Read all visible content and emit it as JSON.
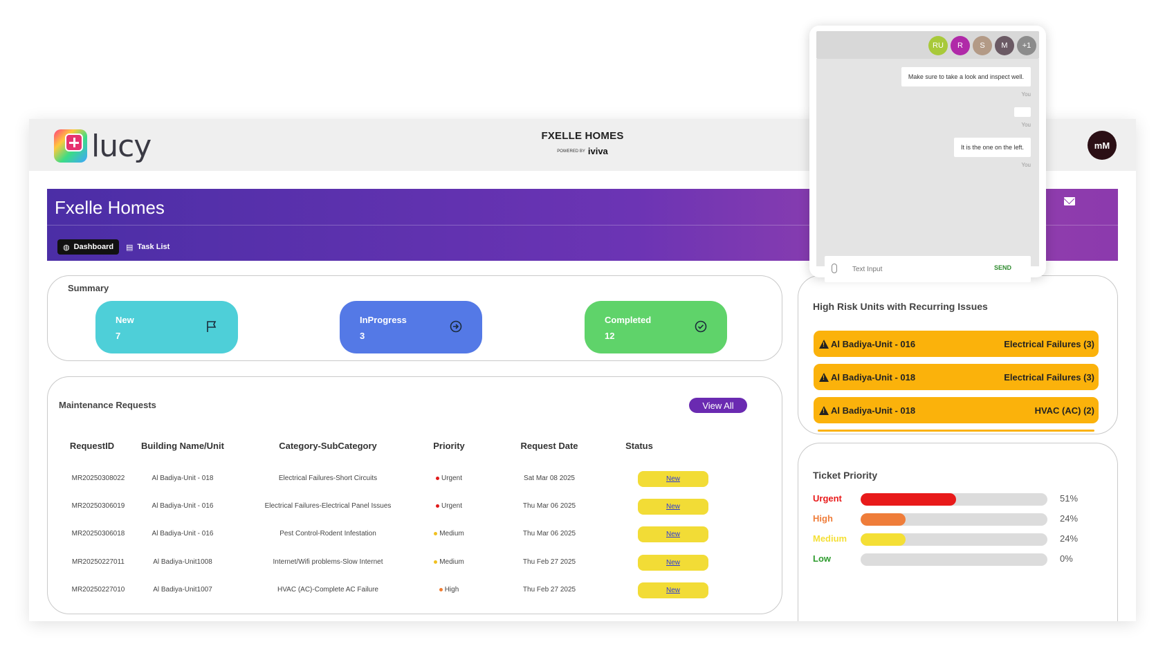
{
  "brand": {
    "logo_text": "lucy",
    "title": "FXELLE HOMES",
    "powered_by": "POWERED BY",
    "powered_brand": "iviva"
  },
  "user": {
    "initials": "mM"
  },
  "banner": {
    "title": "Fxelle Homes",
    "tabs": [
      {
        "label": "Dashboard",
        "active": true
      },
      {
        "label": "Task List",
        "active": false
      }
    ]
  },
  "summary": {
    "title": "Summary",
    "stats": [
      {
        "label": "New",
        "value": "7",
        "color": "#4ecfd8",
        "icon": "flag-icon"
      },
      {
        "label": "InProgress",
        "value": "3",
        "color": "#5479e6",
        "icon": "arrow-circle-icon"
      },
      {
        "label": "Completed",
        "value": "12",
        "color": "#5fd36a",
        "icon": "check-circle-icon"
      }
    ]
  },
  "maintenance": {
    "title": "Maintenance Requests",
    "view_all": "View All",
    "columns": [
      "RequestID",
      "Building Name/Unit",
      "Category-SubCategory",
      "Priority",
      "Request Date",
      "Status"
    ],
    "rows": [
      {
        "id": "MR20250308022",
        "unit": "Al Badiya-Unit - 018",
        "category": "Electrical Failures-Short Circuits",
        "priority": "Urgent",
        "priority_color": "#e01b1b",
        "date": "Sat Mar 08 2025",
        "status": "New"
      },
      {
        "id": "MR20250306019",
        "unit": "Al Badiya-Unit - 016",
        "category": "Electrical Failures-Electrical Panel Issues",
        "priority": "Urgent",
        "priority_color": "#e01b1b",
        "date": "Thu Mar 06 2025",
        "status": "New"
      },
      {
        "id": "MR20250306018",
        "unit": "Al Badiya-Unit - 016",
        "category": "Pest Control-Rodent Infestation",
        "priority": "Medium",
        "priority_color": "#f0c020",
        "date": "Thu Mar 06 2025",
        "status": "New"
      },
      {
        "id": "MR20250227011",
        "unit": "Al Badiya-Unit1008",
        "category": "Internet/Wifi problems-Slow Internet",
        "priority": "Medium",
        "priority_color": "#f0c020",
        "date": "Thu Feb 27 2025",
        "status": "New"
      },
      {
        "id": "MR20250227010",
        "unit": "Al Badiya-Unit1007",
        "category": "HVAC (AC)-Complete AC Failure",
        "priority": "High",
        "priority_color": "#f07c30",
        "date": "Thu Feb 27 2025",
        "status": "New"
      }
    ]
  },
  "risk": {
    "title": "High Risk Units with Recurring Issues",
    "items": [
      {
        "unit": "Al Badiya-Unit - 016",
        "issue": "Electrical Failures (3)"
      },
      {
        "unit": "Al Badiya-Unit - 018",
        "issue": "Electrical Failures (3)"
      },
      {
        "unit": "Al Badiya-Unit - 018",
        "issue": "HVAC (AC) (2)"
      }
    ]
  },
  "ticket_priority": {
    "title": "Ticket Priority",
    "items": [
      {
        "label": "Urgent",
        "percent": 51,
        "pct_text": "51%",
        "color": "#e81a1a"
      },
      {
        "label": "High",
        "percent": 24,
        "pct_text": "24%",
        "color": "#ef7d3a"
      },
      {
        "label": "Medium",
        "percent": 24,
        "pct_text": "24%",
        "color": "#f4df35"
      },
      {
        "label": "Low",
        "percent": 0,
        "pct_text": "0%",
        "color": "#2e9c2e"
      }
    ]
  },
  "chat": {
    "participants": [
      {
        "initials": "RU",
        "color": "#a8c93a"
      },
      {
        "initials": "R",
        "color": "#b02aa8"
      },
      {
        "initials": "S",
        "color": "#b39a86"
      },
      {
        "initials": "M",
        "color": "#6b5a64"
      },
      {
        "initials": "+1",
        "color": "#8c8c8c"
      }
    ],
    "messages": [
      {
        "text": "Make sure to take a look and inspect well.",
        "author": "You"
      },
      {
        "text": "",
        "author": "You"
      },
      {
        "text": "It is the one on the left.",
        "author": "You"
      }
    ],
    "input_placeholder": "Text Input",
    "send_label": "SEND"
  }
}
